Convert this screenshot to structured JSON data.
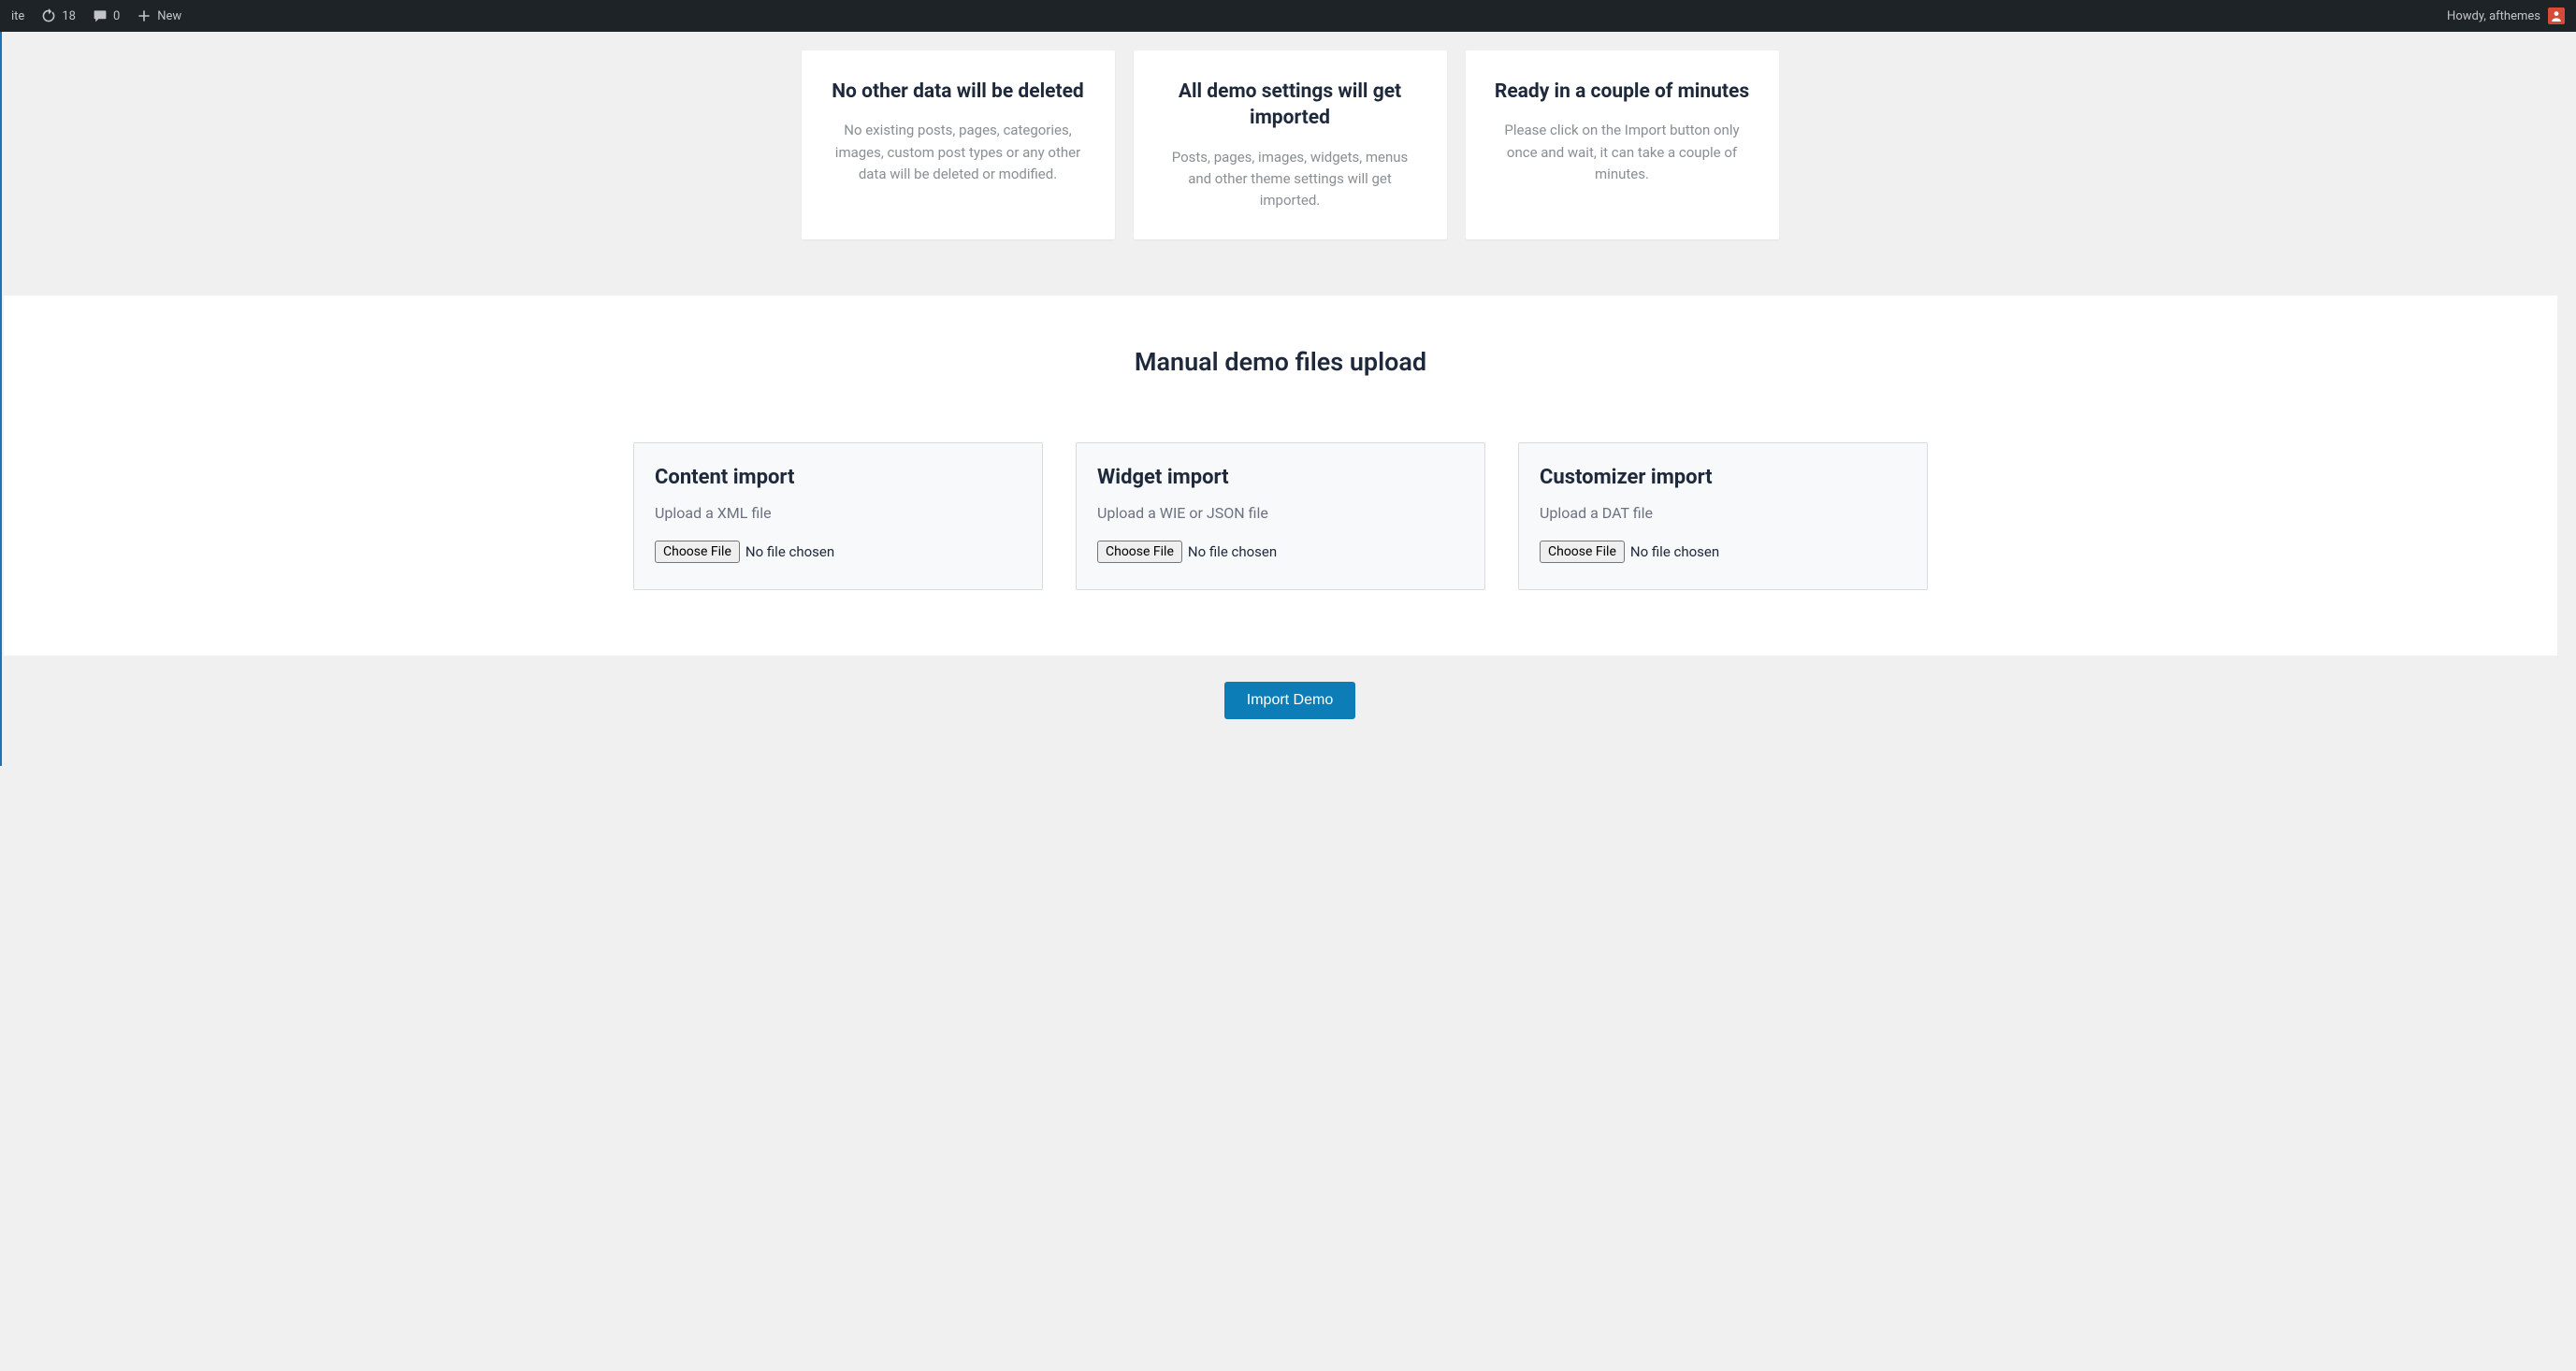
{
  "adminbar": {
    "site_fragment": "ite",
    "updates_count": "18",
    "comments_count": "0",
    "new_label": "New",
    "howdy": "Howdy, afthemes"
  },
  "info_cards": [
    {
      "title": "No other data will be deleted",
      "desc": "No existing posts, pages, categories, images, custom post types or any other data will be deleted or modified."
    },
    {
      "title": "All demo settings will get imported",
      "desc": "Posts, pages, images, widgets, menus and other theme settings will get imported."
    },
    {
      "title": "Ready in a couple of minutes",
      "desc": "Please click on the Import button only once and wait, it can take a couple of minutes."
    }
  ],
  "upload_section": {
    "title": "Manual demo files upload",
    "choose_label": "Choose File",
    "no_file": "No file chosen",
    "cards": [
      {
        "title": "Content import",
        "hint": "Upload a XML file"
      },
      {
        "title": "Widget import",
        "hint": "Upload a WIE or JSON file"
      },
      {
        "title": "Customizer import",
        "hint": "Upload a DAT file"
      }
    ]
  },
  "import_button": "Import Demo"
}
